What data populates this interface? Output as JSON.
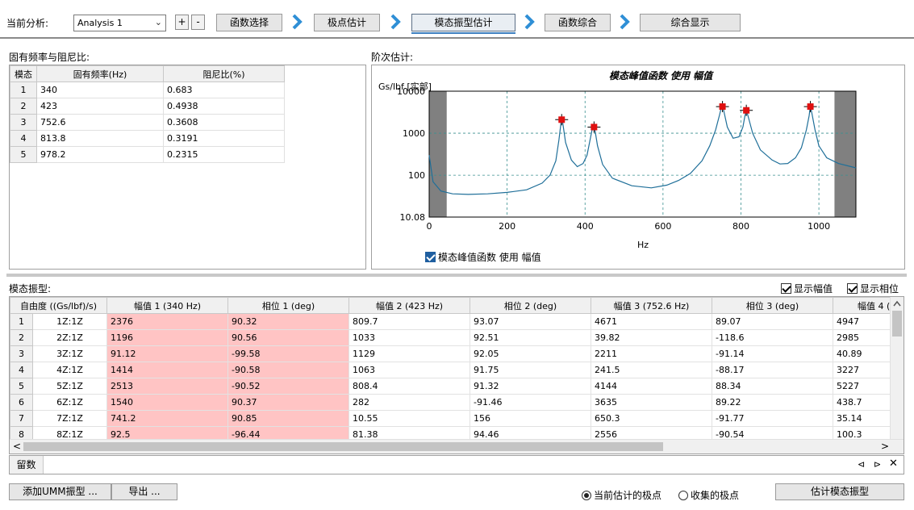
{
  "toolbar": {
    "current_analysis_label": "当前分析:",
    "analysis_value": "Analysis 1",
    "add_label": "+",
    "remove_label": "-",
    "steps": [
      "函数选择",
      "极点估计",
      "模态振型估计",
      "函数综合",
      "综合显示"
    ],
    "active_step": 2
  },
  "freq_panel": {
    "title": "固有频率与阻尼比:",
    "headers": [
      "模态",
      "固有频率(Hz)",
      "阻尼比(%)"
    ],
    "rows": [
      [
        "1",
        "340",
        "0.683"
      ],
      [
        "2",
        "423",
        "0.4938"
      ],
      [
        "3",
        "752.6",
        "0.3608"
      ],
      [
        "4",
        "813.8",
        "0.3191"
      ],
      [
        "5",
        "978.2",
        "0.2315"
      ]
    ]
  },
  "chart_panel": {
    "title": "阶次估计:",
    "legend_label": "模态峰值函数 使用 幅值",
    "colors": {
      "curve": "#1f6f99",
      "marker": "#e01010",
      "shade": "#808080",
      "grid": "#3a8f8f"
    }
  },
  "chart_data": {
    "type": "line",
    "title": "模态峰值函数 使用 幅值",
    "xlabel": "Hz",
    "ylabel": "Gs/lbf [实部]",
    "xlim": [
      0,
      1095
    ],
    "ylim": [
      10.08,
      10000
    ],
    "yscale": "log",
    "xticks": [
      0,
      200,
      400,
      600,
      800,
      1000
    ],
    "yticks": [
      10.08,
      100,
      1000,
      10000
    ],
    "ytick_labels": [
      "10.08",
      "100",
      "1000",
      "10000"
    ],
    "grid": true,
    "shaded_regions": [
      [
        0,
        45
      ],
      [
        1040,
        1095
      ]
    ],
    "series": [
      {
        "x": [
          0,
          10,
          30,
          60,
          100,
          150,
          200,
          250,
          290,
          310,
          325,
          333,
          338,
          340,
          343,
          350,
          365,
          380,
          395,
          405,
          413,
          418,
          421,
          423,
          426,
          432,
          445,
          470,
          520,
          570,
          610,
          640,
          670,
          700,
          720,
          735,
          745,
          750,
          752.6,
          756,
          765,
          780,
          795,
          805,
          810,
          813.8,
          818,
          830,
          850,
          880,
          900,
          920,
          940,
          955,
          968,
          975,
          978.2,
          982,
          990,
          1000,
          1020,
          1050,
          1095
        ],
        "y": [
          300,
          70,
          42,
          36,
          35,
          36,
          39,
          45,
          65,
          100,
          220,
          700,
          1700,
          2400,
          1700,
          600,
          230,
          160,
          190,
          300,
          700,
          1200,
          1400,
          1450,
          1100,
          500,
          180,
          85,
          56,
          50,
          58,
          75,
          110,
          220,
          500,
          1200,
          2700,
          4200,
          4600,
          3400,
          1400,
          760,
          820,
          1400,
          2500,
          3500,
          2600,
          1000,
          400,
          230,
          185,
          190,
          260,
          450,
          1200,
          2600,
          4500,
          3000,
          1200,
          500,
          260,
          190,
          150
        ]
      }
    ],
    "markers": [
      {
        "x": 340,
        "y": 2100
      },
      {
        "x": 423,
        "y": 1400
      },
      {
        "x": 752.6,
        "y": 4300
      },
      {
        "x": 813.8,
        "y": 3500
      },
      {
        "x": 978.2,
        "y": 4300
      }
    ]
  },
  "modes_panel": {
    "title": "模态振型:",
    "show_amplitude_label": "显示幅值",
    "show_phase_label": "显示相位",
    "show_amplitude": true,
    "show_phase": true,
    "headers": [
      "自由度 ((Gs/lbf)/s)",
      "幅值 1 (340 Hz)",
      "相位 1 (deg)",
      "幅值 2 (423 Hz)",
      "相位 2 (deg)",
      "幅值 3 (752.6 Hz)",
      "相位 3 (deg)",
      "幅值 4 ("
    ],
    "rows": [
      [
        "1",
        "1Z:1Z",
        "2376",
        "90.32",
        "809.7",
        "93.07",
        "4671",
        "89.07",
        "4947"
      ],
      [
        "2",
        "2Z:1Z",
        "1196",
        "90.56",
        "1033",
        "92.51",
        "39.82",
        "-118.6",
        "2985"
      ],
      [
        "3",
        "3Z:1Z",
        "91.12",
        "-99.58",
        "1129",
        "92.05",
        "2211",
        "-91.14",
        "40.89"
      ],
      [
        "4",
        "4Z:1Z",
        "1414",
        "-90.58",
        "1063",
        "91.75",
        "241.5",
        "-88.17",
        "3227"
      ],
      [
        "5",
        "5Z:1Z",
        "2513",
        "-90.52",
        "808.4",
        "91.32",
        "4144",
        "88.34",
        "5227"
      ],
      [
        "6",
        "6Z:1Z",
        "1540",
        "90.37",
        "282",
        "-91.46",
        "3635",
        "89.22",
        "438.7"
      ],
      [
        "7",
        "7Z:1Z",
        "741.2",
        "90.85",
        "10.55",
        "156",
        "650.3",
        "-91.77",
        "35.14"
      ],
      [
        "8",
        "8Z:1Z",
        "92.5",
        "-96.44",
        "81.38",
        "94.46",
        "2556",
        "-90.54",
        "100.3"
      ]
    ],
    "scroll_left": "<",
    "scroll_right": ">",
    "residual_label": "留数",
    "nav_prev": "⊲",
    "nav_next": "⊳",
    "close": "✕"
  },
  "footer": {
    "add_umm_label": "添加UMM振型 ...",
    "export_label": "导出 ...",
    "radio_current_label": "当前估计的极点",
    "radio_collected_label": "收集的极点",
    "estimate_label": "估计模态振型"
  }
}
